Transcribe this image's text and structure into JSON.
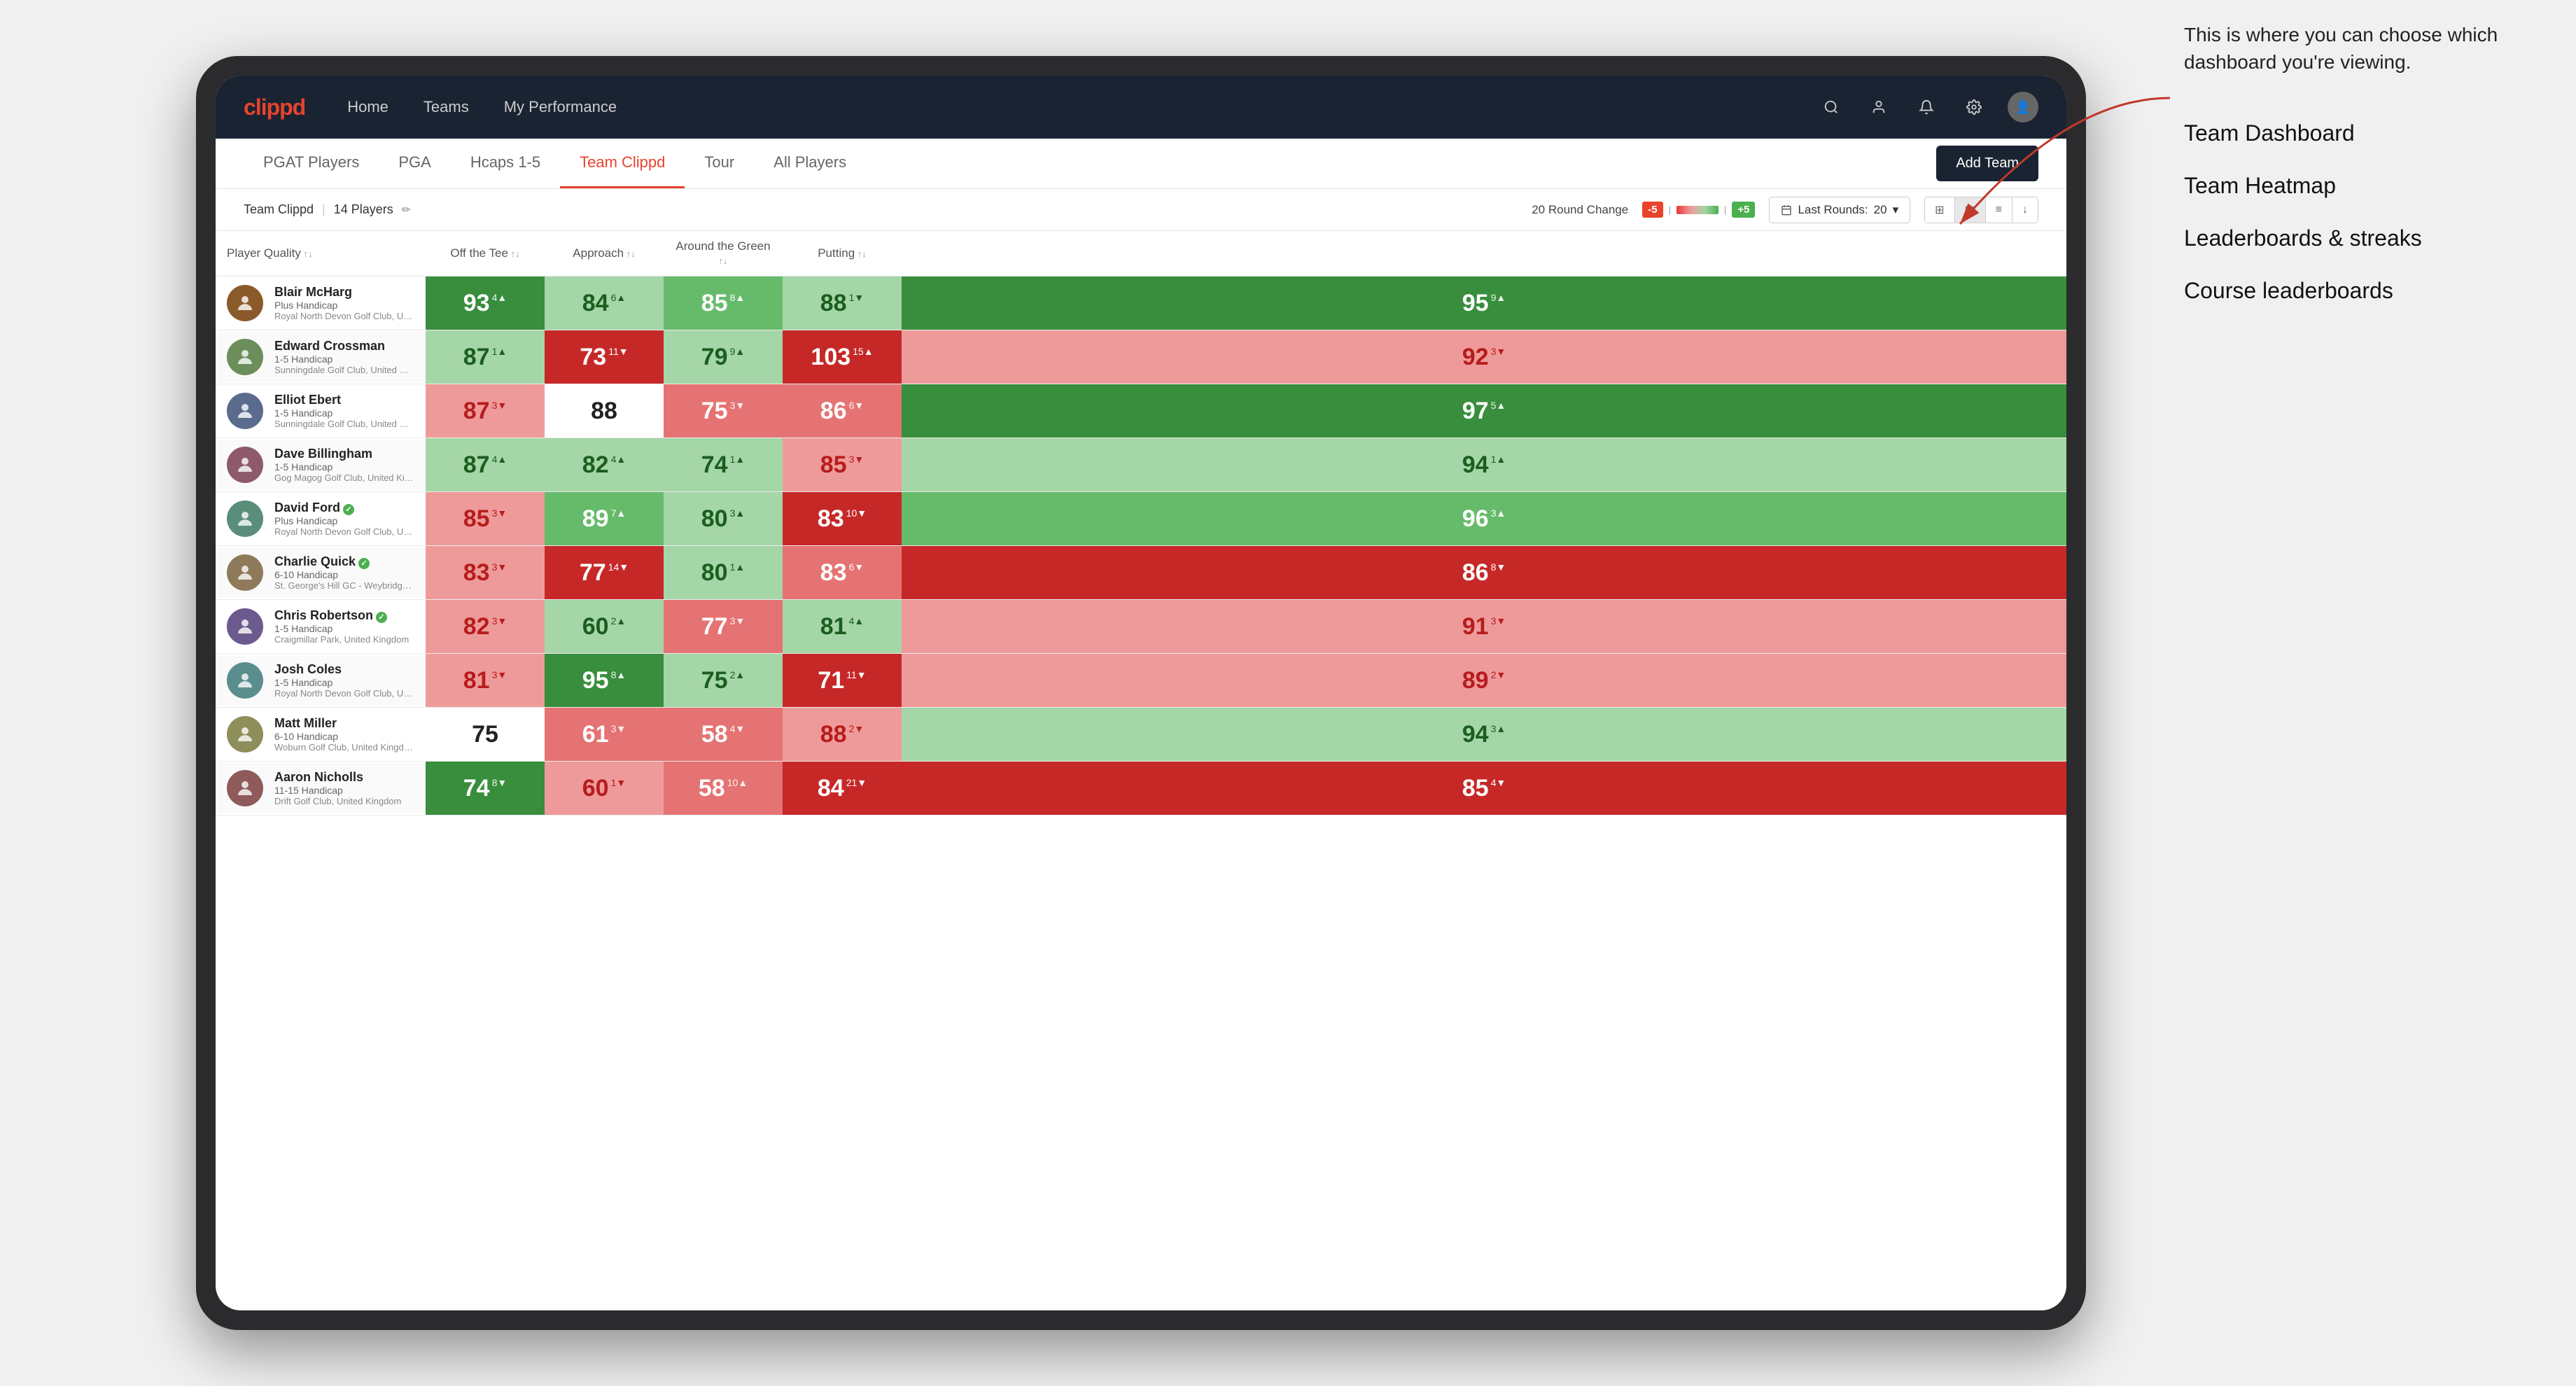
{
  "annotation": {
    "intro": "This is where you can choose which dashboard you're viewing.",
    "options": [
      "Team Dashboard",
      "Team Heatmap",
      "Leaderboards & streaks",
      "Course leaderboards"
    ]
  },
  "navbar": {
    "logo": "clippd",
    "nav_items": [
      "Home",
      "Teams",
      "My Performance"
    ],
    "icons": [
      "search",
      "user",
      "bell",
      "settings",
      "avatar"
    ]
  },
  "subnav": {
    "tabs": [
      "PGAT Players",
      "PGA",
      "Hcaps 1-5",
      "Team Clippd",
      "Tour",
      "All Players"
    ],
    "active_tab": "Team Clippd",
    "add_team_label": "Add Team"
  },
  "teambar": {
    "team_name": "Team Clippd",
    "player_count": "14 Players",
    "round_change_label": "20 Round Change",
    "change_neg": "-5",
    "change_pos": "+5",
    "last_rounds_label": "Last Rounds:",
    "last_rounds_value": "20"
  },
  "table": {
    "headers": [
      "Player Quality",
      "Off the Tee",
      "Approach",
      "Around the Green",
      "Putting"
    ],
    "players": [
      {
        "name": "Blair McHarg",
        "handicap": "Plus Handicap",
        "club": "Royal North Devon Golf Club, United Kingdom",
        "scores": [
          {
            "value": 93,
            "change": 4,
            "dir": "up",
            "color": "bg-green-dark"
          },
          {
            "value": 84,
            "change": 6,
            "dir": "up",
            "color": "bg-green-light"
          },
          {
            "value": 85,
            "change": 8,
            "dir": "up",
            "color": "bg-green-medium"
          },
          {
            "value": 88,
            "change": 1,
            "dir": "down",
            "color": "bg-green-light"
          },
          {
            "value": 95,
            "change": 9,
            "dir": "up",
            "color": "bg-green-dark"
          }
        ]
      },
      {
        "name": "Edward Crossman",
        "handicap": "1-5 Handicap",
        "club": "Sunningdale Golf Club, United Kingdom",
        "scores": [
          {
            "value": 87,
            "change": 1,
            "dir": "up",
            "color": "bg-green-light"
          },
          {
            "value": 73,
            "change": 11,
            "dir": "down",
            "color": "bg-red-dark"
          },
          {
            "value": 79,
            "change": 9,
            "dir": "up",
            "color": "bg-green-light"
          },
          {
            "value": 103,
            "change": 15,
            "dir": "up",
            "color": "bg-red-dark"
          },
          {
            "value": 92,
            "change": 3,
            "dir": "down",
            "color": "bg-red-light"
          }
        ]
      },
      {
        "name": "Elliot Ebert",
        "handicap": "1-5 Handicap",
        "club": "Sunningdale Golf Club, United Kingdom",
        "scores": [
          {
            "value": 87,
            "change": 3,
            "dir": "down",
            "color": "bg-red-light"
          },
          {
            "value": 88,
            "change": null,
            "dir": "none",
            "color": "bg-white"
          },
          {
            "value": 75,
            "change": 3,
            "dir": "down",
            "color": "bg-red-medium"
          },
          {
            "value": 86,
            "change": 6,
            "dir": "down",
            "color": "bg-red-medium"
          },
          {
            "value": 97,
            "change": 5,
            "dir": "up",
            "color": "bg-green-dark"
          }
        ]
      },
      {
        "name": "Dave Billingham",
        "handicap": "1-5 Handicap",
        "club": "Gog Magog Golf Club, United Kingdom",
        "scores": [
          {
            "value": 87,
            "change": 4,
            "dir": "up",
            "color": "bg-green-light"
          },
          {
            "value": 82,
            "change": 4,
            "dir": "up",
            "color": "bg-green-light"
          },
          {
            "value": 74,
            "change": 1,
            "dir": "up",
            "color": "bg-green-light"
          },
          {
            "value": 85,
            "change": 3,
            "dir": "down",
            "color": "bg-red-light"
          },
          {
            "value": 94,
            "change": 1,
            "dir": "up",
            "color": "bg-green-light"
          }
        ]
      },
      {
        "name": "David Ford",
        "handicap": "Plus Handicap",
        "club": "Royal North Devon Golf Club, United Kingdom",
        "verified": true,
        "scores": [
          {
            "value": 85,
            "change": 3,
            "dir": "down",
            "color": "bg-red-light"
          },
          {
            "value": 89,
            "change": 7,
            "dir": "up",
            "color": "bg-green-medium"
          },
          {
            "value": 80,
            "change": 3,
            "dir": "up",
            "color": "bg-green-light"
          },
          {
            "value": 83,
            "change": 10,
            "dir": "down",
            "color": "bg-red-dark"
          },
          {
            "value": 96,
            "change": 3,
            "dir": "up",
            "color": "bg-green-medium"
          }
        ]
      },
      {
        "name": "Charlie Quick",
        "handicap": "6-10 Handicap",
        "club": "St. George's Hill GC - Weybridge - Surrey, Uni...",
        "verified": true,
        "scores": [
          {
            "value": 83,
            "change": 3,
            "dir": "down",
            "color": "bg-red-light"
          },
          {
            "value": 77,
            "change": 14,
            "dir": "down",
            "color": "bg-red-dark"
          },
          {
            "value": 80,
            "change": 1,
            "dir": "up",
            "color": "bg-green-light"
          },
          {
            "value": 83,
            "change": 6,
            "dir": "down",
            "color": "bg-red-medium"
          },
          {
            "value": 86,
            "change": 8,
            "dir": "down",
            "color": "bg-red-dark"
          }
        ]
      },
      {
        "name": "Chris Robertson",
        "handicap": "1-5 Handicap",
        "club": "Craigmillar Park, United Kingdom",
        "verified": true,
        "scores": [
          {
            "value": 82,
            "change": 3,
            "dir": "down",
            "color": "bg-red-light"
          },
          {
            "value": 60,
            "change": 2,
            "dir": "up",
            "color": "bg-green-light"
          },
          {
            "value": 77,
            "change": 3,
            "dir": "down",
            "color": "bg-red-medium"
          },
          {
            "value": 81,
            "change": 4,
            "dir": "up",
            "color": "bg-green-light"
          },
          {
            "value": 91,
            "change": 3,
            "dir": "down",
            "color": "bg-red-light"
          }
        ]
      },
      {
        "name": "Josh Coles",
        "handicap": "1-5 Handicap",
        "club": "Royal North Devon Golf Club, United Kingdom",
        "scores": [
          {
            "value": 81,
            "change": 3,
            "dir": "down",
            "color": "bg-red-light"
          },
          {
            "value": 95,
            "change": 8,
            "dir": "up",
            "color": "bg-green-dark"
          },
          {
            "value": 75,
            "change": 2,
            "dir": "up",
            "color": "bg-green-light"
          },
          {
            "value": 71,
            "change": 11,
            "dir": "down",
            "color": "bg-red-dark"
          },
          {
            "value": 89,
            "change": 2,
            "dir": "down",
            "color": "bg-red-light"
          }
        ]
      },
      {
        "name": "Matt Miller",
        "handicap": "6-10 Handicap",
        "club": "Woburn Golf Club, United Kingdom",
        "scores": [
          {
            "value": 75,
            "change": null,
            "dir": "none",
            "color": "bg-white"
          },
          {
            "value": 61,
            "change": 3,
            "dir": "down",
            "color": "bg-red-medium"
          },
          {
            "value": 58,
            "change": 4,
            "dir": "down",
            "color": "bg-red-medium"
          },
          {
            "value": 88,
            "change": 2,
            "dir": "down",
            "color": "bg-red-light"
          },
          {
            "value": 94,
            "change": 3,
            "dir": "up",
            "color": "bg-green-light"
          }
        ]
      },
      {
        "name": "Aaron Nicholls",
        "handicap": "11-15 Handicap",
        "club": "Drift Golf Club, United Kingdom",
        "scores": [
          {
            "value": 74,
            "change": 8,
            "dir": "down",
            "color": "bg-green-dark"
          },
          {
            "value": 60,
            "change": 1,
            "dir": "down",
            "color": "bg-red-light"
          },
          {
            "value": 58,
            "change": 10,
            "dir": "up",
            "color": "bg-red-medium"
          },
          {
            "value": 84,
            "change": 21,
            "dir": "down",
            "color": "bg-red-dark"
          },
          {
            "value": 85,
            "change": 4,
            "dir": "down",
            "color": "bg-red-dark"
          }
        ]
      }
    ]
  }
}
